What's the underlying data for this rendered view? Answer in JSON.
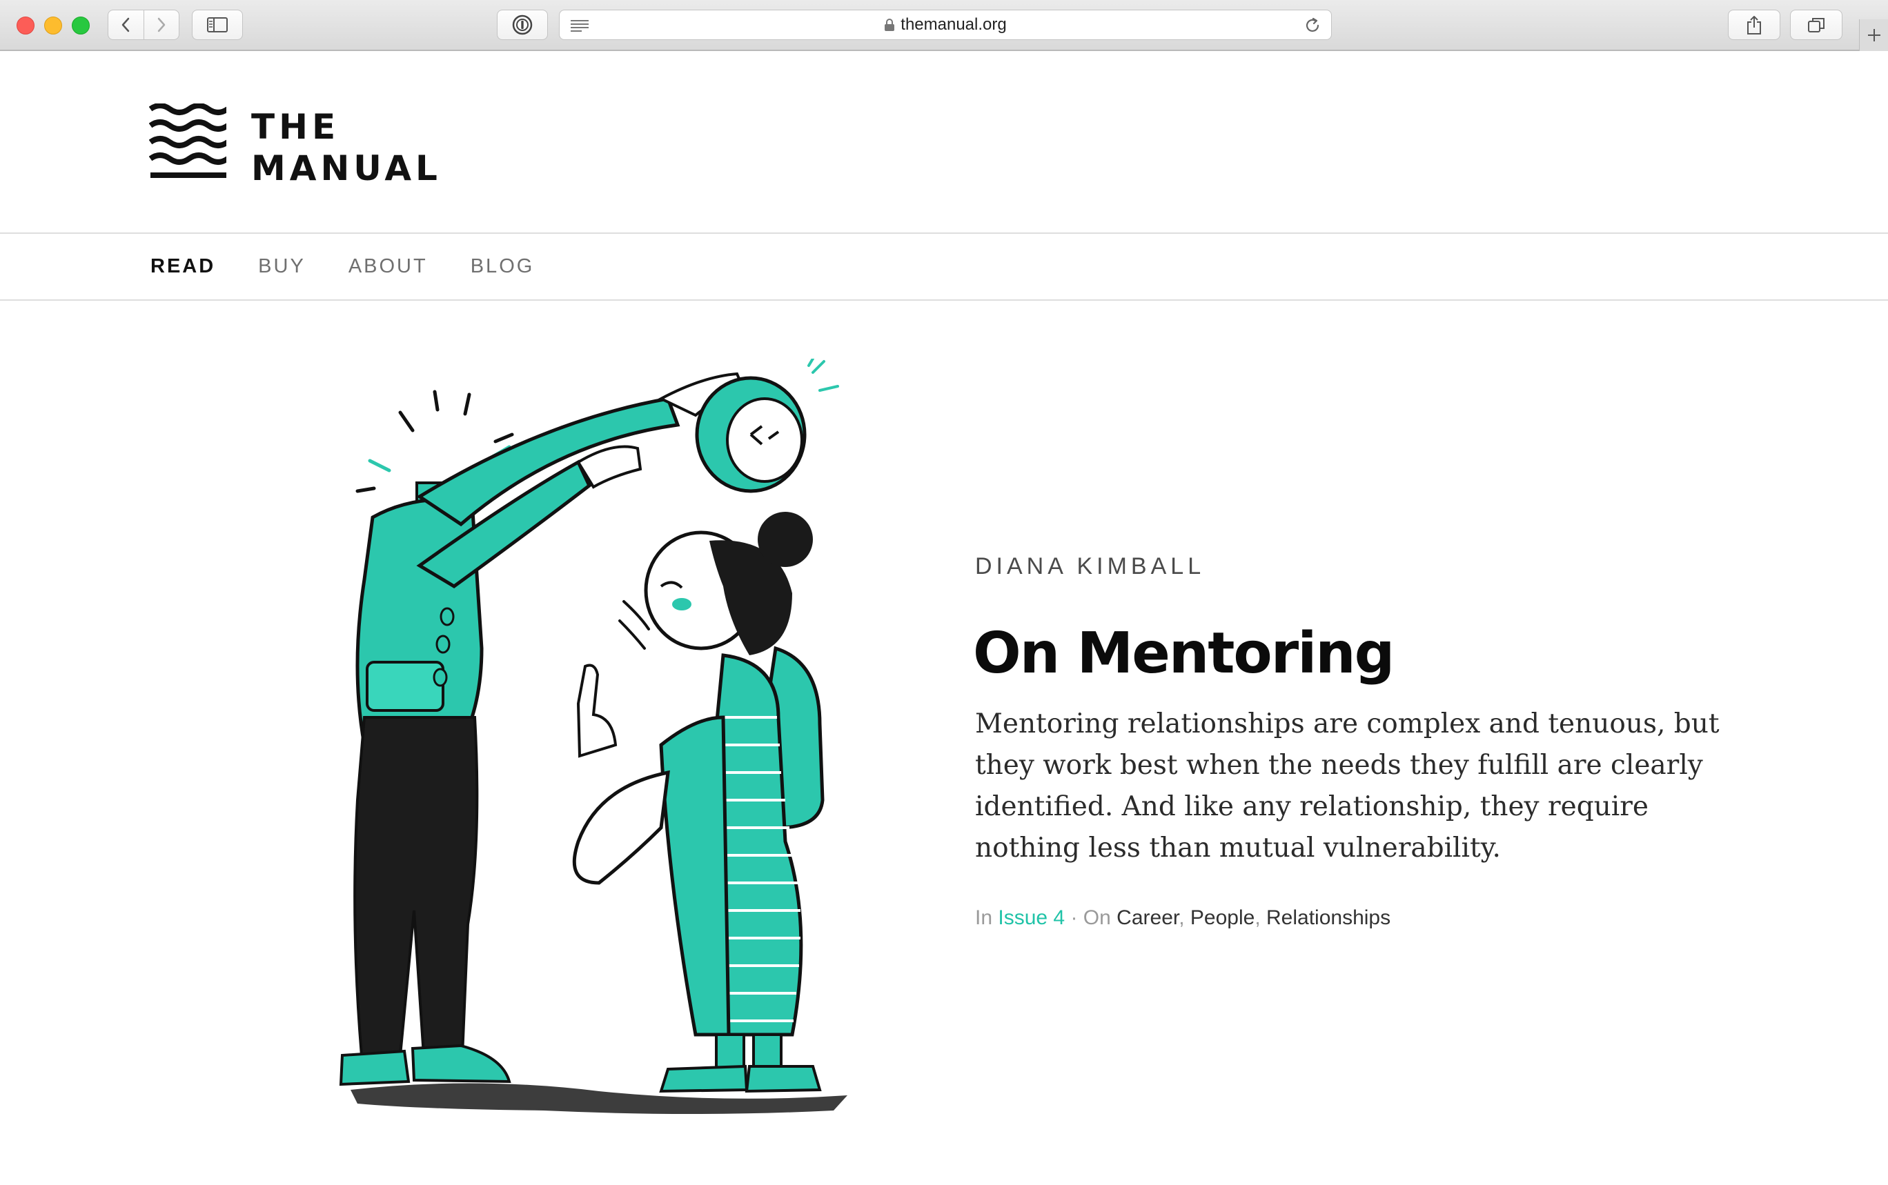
{
  "browser": {
    "url": "themanual.org"
  },
  "site": {
    "logo_line1": "THE",
    "logo_line2": "MANUAL"
  },
  "nav": {
    "items": [
      {
        "label": "READ",
        "active": true
      },
      {
        "label": "BUY",
        "active": false
      },
      {
        "label": "ABOUT",
        "active": false
      },
      {
        "label": "BLOG",
        "active": false
      }
    ]
  },
  "article": {
    "author": "DIANA KIMBALL",
    "title": "On Mentoring",
    "dek": "Mentoring relationships are complex and tenuous, but they work best when the needs they fulfill are clearly identified. And like any relationship, they require nothing less than mutual vulnerability.",
    "meta": {
      "in_label": "In",
      "issue": "Issue 4",
      "separator": "·",
      "on_label": "On",
      "tags": [
        "Career",
        "People",
        "Relationships"
      ]
    }
  },
  "colors": {
    "accent": "#21c3a8",
    "text": "#111111",
    "muted": "#9a9a9a"
  },
  "icons": {
    "lock": "lock-icon",
    "reload": "reload-icon",
    "reader": "reader-icon",
    "share": "share-icon",
    "tabs": "tabs-icon"
  }
}
